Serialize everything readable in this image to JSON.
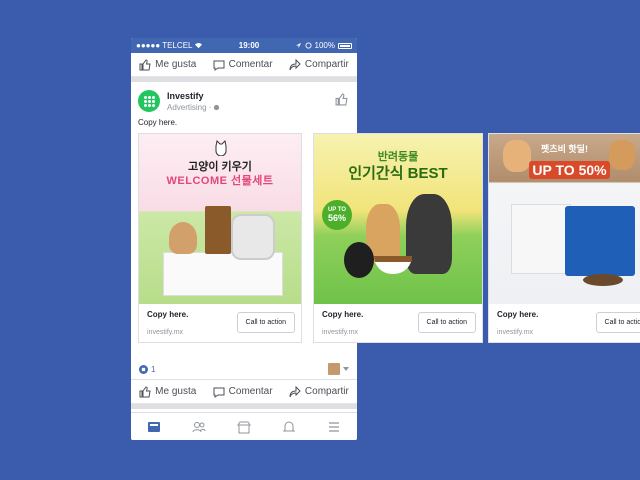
{
  "status": {
    "carrier": "●●●●● TELCEL",
    "time": "19:00",
    "battery": "100%"
  },
  "actions": {
    "like": "Me gusta",
    "comment": "Comentar",
    "share": "Compartir"
  },
  "post": {
    "name": "Investify",
    "sponsored": "Advertising · ",
    "copy": "Copy here."
  },
  "cards": [
    {
      "line1": "고양이 키우기",
      "line2": "WELCOME 선물세트",
      "title": "Copy here.",
      "site": "investify.mx",
      "cta": "Call to action"
    },
    {
      "line1": "반려동물",
      "line2": "인기간식 BEST",
      "badge_top": "UP TO",
      "badge_val": "56%",
      "title": "Copy here.",
      "site": "investify.mx",
      "cta": "Call to action"
    },
    {
      "line1": "펫츠비 핫딜!",
      "line2": "UP TO 50%",
      "title": "Copy here.",
      "site": "investify.mx",
      "cta": "Call to action"
    }
  ],
  "reactions": {
    "count": "1"
  },
  "colors": {
    "brand": "#4267b2",
    "background": "#3b5cad",
    "logo": "#22c55e"
  }
}
